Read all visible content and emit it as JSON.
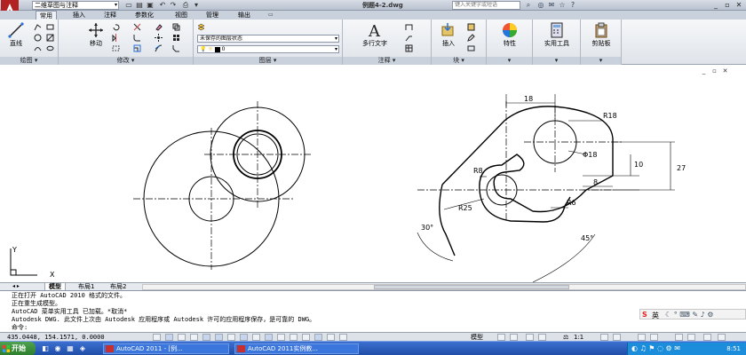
{
  "titlebar": {
    "workspace": "二维草图与注释",
    "doc_title": "例题4-2.dwg",
    "search_placeholder": "键入关键字或短语",
    "quick_access": [
      "save-icon",
      "undo-icon",
      "redo-icon",
      "print-icon"
    ]
  },
  "tabs": [
    "常用",
    "插入",
    "注释",
    "参数化",
    "视图",
    "管理",
    "输出"
  ],
  "active_tab": "常用",
  "ribbon": {
    "draw": {
      "title": "绘图",
      "line_label": "直线"
    },
    "modify": {
      "title": "修改",
      "move_label": "移动"
    },
    "layers": {
      "title": "图层",
      "layer_state": "未保存的图层状态",
      "current_layer": "0"
    },
    "annotation": {
      "title": "注释",
      "mtext_label": "多行文字"
    },
    "block": {
      "title": "块",
      "insert_label": "插入"
    },
    "properties": {
      "label": "特性"
    },
    "utilities": {
      "label": "实用工具"
    },
    "clipboard": {
      "label": "剪贴板"
    }
  },
  "drawing": {
    "dims": {
      "d18": "18",
      "r18": "R18",
      "phi18": "Φ18",
      "d10": "10",
      "d27": "27",
      "r8": "R8",
      "d8": "8",
      "r25": "R25",
      "r6": "R6",
      "a30": "30°",
      "a45": "45°"
    },
    "ucs": {
      "x": "X",
      "y": "Y"
    }
  },
  "layout_tabs": [
    "模型",
    "布局1",
    "布局2"
  ],
  "active_layout": "模型",
  "command_lines": [
    "正在打开 AutoCAD 2010 格式的文件。",
    "正在重生成模型。",
    "AutoCAD 菜单实用工具 已加载。*取消*",
    "Autodesk DWG.   此文件上次由 Autodesk 应用程序或 Autodesk 许可的应用程序保存，是可靠的 DWG。",
    "命令:"
  ],
  "status": {
    "coords": "435.0448, 154.1571, 0.0000",
    "model_label": "模型",
    "scale": "1:1"
  },
  "taskbar": {
    "start_label": "开始",
    "tasks": [
      "AutoCAD 2011 - [例...",
      "AutoCAD 2011实例教..."
    ],
    "time": "8:51",
    "ime": "英"
  },
  "colors": {
    "ribbon_tab_bg": "#c9d1dd",
    "taskbar_blue": "#1f4ea8",
    "start_green": "#2b7c2b"
  }
}
